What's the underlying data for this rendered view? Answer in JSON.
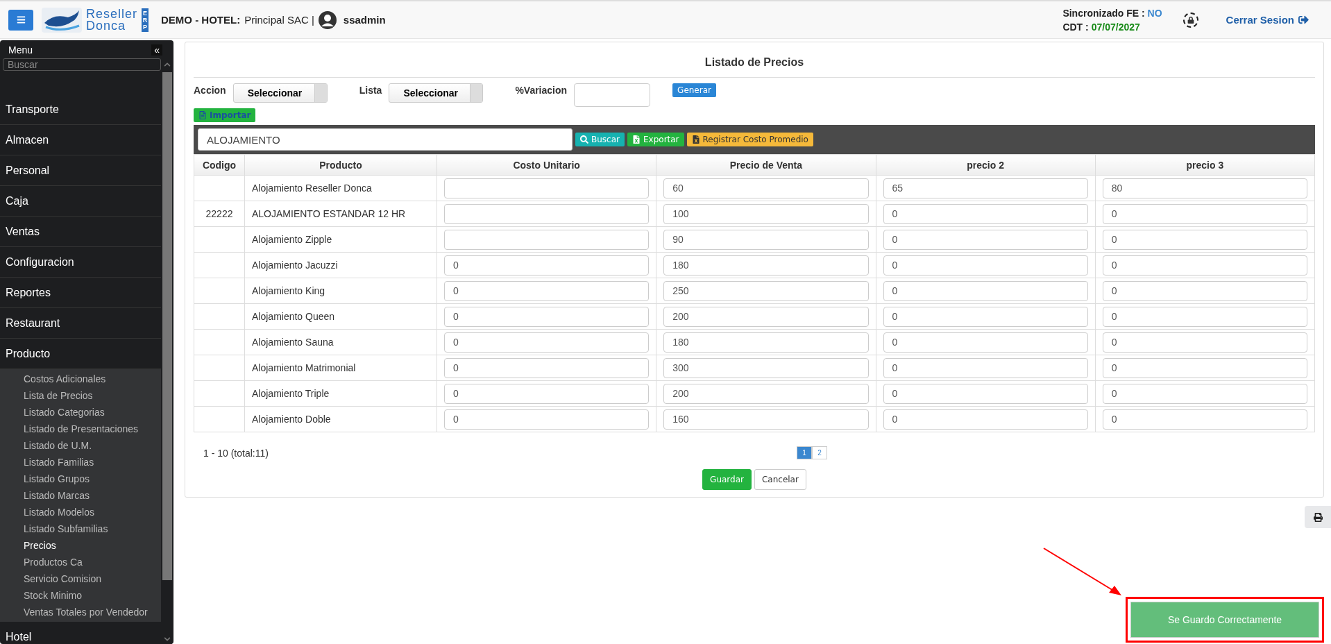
{
  "header": {
    "brand_line1": "Reseller",
    "brand_line2": "Donca",
    "brand_tag": "ERP",
    "company_label": "DEMO - HOTEL:",
    "company": "Principal SAC |",
    "user": "ssadmin",
    "sync_label": "Sincronizado FE :",
    "sync_value": "NO",
    "cdt_label": "CDT :",
    "cdt_value": "07/07/2027",
    "logout": "Cerrar Sesion"
  },
  "sidebar": {
    "title": "Menu",
    "collapse": "«",
    "search_placeholder": "Buscar",
    "items": [
      {
        "label": "Transporte"
      },
      {
        "label": "Almacen"
      },
      {
        "label": "Personal"
      },
      {
        "label": "Caja"
      },
      {
        "label": "Ventas"
      },
      {
        "label": "Configuracion"
      },
      {
        "label": "Reportes"
      },
      {
        "label": "Restaurant"
      },
      {
        "label": "Producto",
        "children": [
          {
            "label": "Costos Adicionales",
            "selected": false
          },
          {
            "label": "Lista de Precios",
            "selected": false
          },
          {
            "label": "Listado Categorias",
            "selected": false
          },
          {
            "label": "Listado de Presentaciones",
            "selected": false
          },
          {
            "label": "Listado de U.M.",
            "selected": false
          },
          {
            "label": "Listado Familias",
            "selected": false
          },
          {
            "label": "Listado Grupos",
            "selected": false
          },
          {
            "label": "Listado Marcas",
            "selected": false
          },
          {
            "label": "Listado Modelos",
            "selected": false
          },
          {
            "label": "Listado Subfamilias",
            "selected": false
          },
          {
            "label": "Precios",
            "selected": true
          },
          {
            "label": "Productos Ca",
            "selected": false
          },
          {
            "label": "Servicio Comision",
            "selected": false
          },
          {
            "label": "Stock Minimo",
            "selected": false
          },
          {
            "label": "Ventas Totales por Vendedor",
            "selected": false
          }
        ]
      },
      {
        "label": "Hotel"
      }
    ]
  },
  "panel": {
    "title": "Listado de Precios",
    "accion_label": "Accion",
    "accion_value": "Seleccionar",
    "lista_label": "Lista",
    "lista_value": "Seleccionar",
    "variacion_label": "%Variacion",
    "generar": "Generar",
    "importar": "Importar",
    "search_value": "ALOJAMIENTO",
    "buscar": "Buscar",
    "exportar": "Exportar",
    "registrar": "Registrar Costo Promedio",
    "columns": [
      "Codigo",
      "Producto",
      "Costo Unitario",
      "Precio de Venta",
      "precio 2",
      "precio 3"
    ],
    "rows": [
      {
        "producto": "Alojamiento Reseller Donca",
        "venta": "60",
        "p2": "65",
        "p3": "80"
      },
      {
        "codigo": "22222",
        "producto": "ALOJAMIENTO ESTANDAR 12 HR",
        "venta": "100",
        "p2": "0",
        "p3": "0"
      },
      {
        "producto": "Alojamiento Zipple",
        "venta": "90",
        "p2": "0",
        "p3": "0"
      },
      {
        "producto": "Alojamiento Jacuzzi",
        "costo": "0",
        "venta": "180",
        "p2": "0",
        "p3": "0"
      },
      {
        "producto": "Alojamiento King",
        "costo": "0",
        "venta": "250",
        "p2": "0",
        "p3": "0"
      },
      {
        "producto": "Alojamiento Queen",
        "costo": "0",
        "venta": "200",
        "p2": "0",
        "p3": "0"
      },
      {
        "producto": "Alojamiento Sauna",
        "costo": "0",
        "venta": "180",
        "p2": "0",
        "p3": "0"
      },
      {
        "producto": "Alojamiento Matrimonial",
        "costo": "0",
        "venta": "300",
        "p2": "0",
        "p3": "0"
      },
      {
        "producto": "Alojamiento Triple",
        "costo": "0",
        "venta": "200",
        "p2": "0",
        "p3": "0"
      },
      {
        "producto": "Alojamiento Doble",
        "costo": "0",
        "venta": "160",
        "p2": "0",
        "p3": "0"
      }
    ],
    "range": "1 - 10 (total:11)",
    "pages": [
      {
        "label": "1",
        "selected": true
      },
      {
        "label": "2",
        "selected": false
      }
    ],
    "guardar": "Guardar",
    "cancelar": "Cancelar"
  },
  "toast": {
    "message": "Se Guardo Correctamente"
  }
}
